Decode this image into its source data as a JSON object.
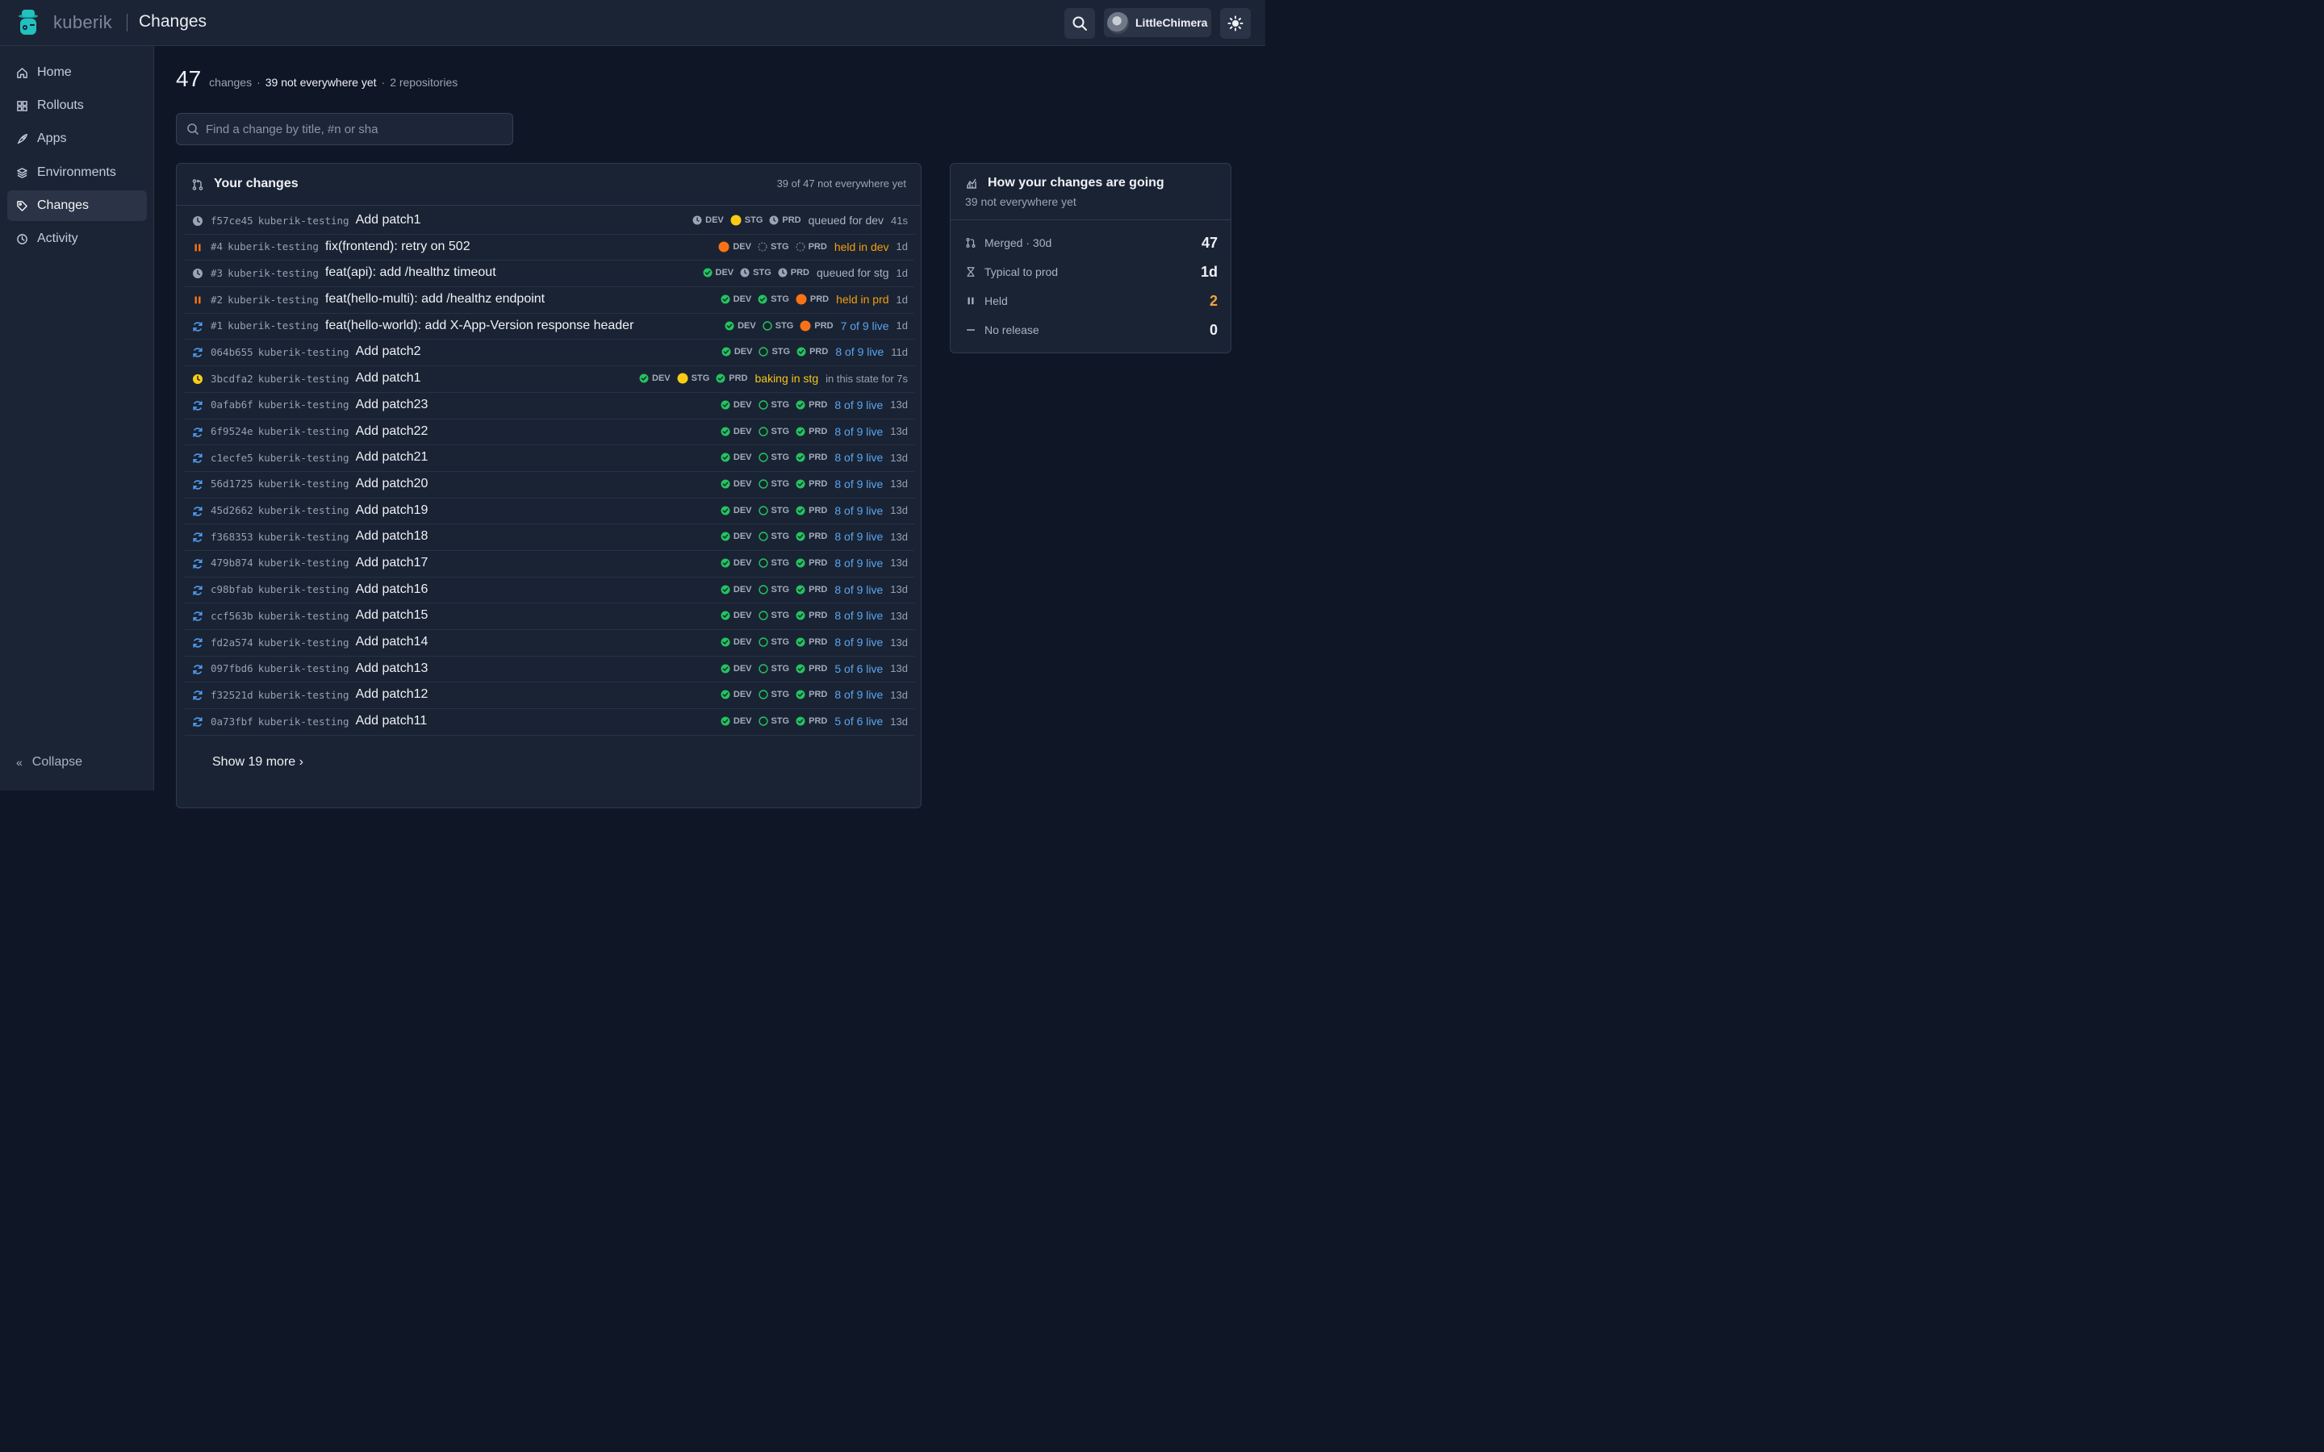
{
  "app": {
    "brand": "kuberik",
    "page_title": "Changes"
  },
  "user": {
    "name": "LittleChimera"
  },
  "sidebar": {
    "items": [
      {
        "label": "Home",
        "icon": "home-icon"
      },
      {
        "label": "Rollouts",
        "icon": "grid-icon"
      },
      {
        "label": "Apps",
        "icon": "rocket-icon"
      },
      {
        "label": "Environments",
        "icon": "layers-icon"
      },
      {
        "label": "Changes",
        "icon": "tag-icon",
        "active": true
      },
      {
        "label": "Activity",
        "icon": "clock-icon"
      }
    ],
    "collapse_label": "Collapse"
  },
  "summary": {
    "count": "47",
    "count_label": "changes",
    "not_everywhere": "39 not everywhere yet",
    "repositories": "2 repositories"
  },
  "search": {
    "placeholder": "Find a change by title, #n or sha"
  },
  "changes_panel": {
    "title": "Your changes",
    "count_text": "39 of 47 not everywhere yet",
    "show_more": "Show 19 more ›"
  },
  "env_labels": {
    "dev": "DEV",
    "stg": "STG",
    "prd": "PRD"
  },
  "rows": [
    {
      "status": "queued",
      "sha": "f57ce45",
      "repo": "kuberik-testing",
      "title": "Add patch1",
      "dev": "queued",
      "stg": "baking",
      "prd": "queued",
      "state": "queued for dev",
      "state_tone": "grey",
      "age": "41s"
    },
    {
      "status": "held",
      "sha": "#4",
      "repo": "kuberik-testing",
      "title": "fix(frontend): retry on 502",
      "dev": "held",
      "stg": "pending",
      "prd": "pending",
      "state": "held in dev",
      "state_tone": "orange",
      "age": "1d"
    },
    {
      "status": "queued",
      "sha": "#3",
      "repo": "kuberik-testing",
      "title": "feat(api): add /healthz timeout",
      "dev": "done",
      "stg": "queued",
      "prd": "queued",
      "state": "queued for stg",
      "state_tone": "grey",
      "age": "1d"
    },
    {
      "status": "held",
      "sha": "#2",
      "repo": "kuberik-testing",
      "title": "feat(hello-multi): add /healthz endpoint",
      "dev": "done",
      "stg": "done",
      "prd": "held",
      "state": "held in prd",
      "state_tone": "orange",
      "age": "1d"
    },
    {
      "status": "sync",
      "sha": "#1",
      "repo": "kuberik-testing",
      "title": "feat(hello-world): add X-App-Version response header",
      "dev": "done",
      "stg": "partial",
      "prd": "held",
      "state": "7 of 9 live",
      "state_tone": "blue",
      "age": "1d"
    },
    {
      "status": "sync",
      "sha": "064b655",
      "repo": "kuberik-testing",
      "title": "Add patch2",
      "dev": "done",
      "stg": "partial",
      "prd": "done",
      "state": "8 of 9 live",
      "state_tone": "blue",
      "age": "11d"
    },
    {
      "status": "baking",
      "sha": "3bcdfa2",
      "repo": "kuberik-testing",
      "title": "Add patch1",
      "dev": "done",
      "stg": "baking",
      "prd": "done",
      "state": "baking in stg",
      "state_tone": "yellow",
      "extra": "in this state for 7s",
      "age": ""
    },
    {
      "status": "sync",
      "sha": "0afab6f",
      "repo": "kuberik-testing",
      "title": "Add patch23",
      "dev": "done",
      "stg": "partial",
      "prd": "done",
      "state": "8 of 9 live",
      "state_tone": "blue",
      "age": "13d"
    },
    {
      "status": "sync",
      "sha": "6f9524e",
      "repo": "kuberik-testing",
      "title": "Add patch22",
      "dev": "done",
      "stg": "partial",
      "prd": "done",
      "state": "8 of 9 live",
      "state_tone": "blue",
      "age": "13d"
    },
    {
      "status": "sync",
      "sha": "c1ecfe5",
      "repo": "kuberik-testing",
      "title": "Add patch21",
      "dev": "done",
      "stg": "partial",
      "prd": "done",
      "state": "8 of 9 live",
      "state_tone": "blue",
      "age": "13d"
    },
    {
      "status": "sync",
      "sha": "56d1725",
      "repo": "kuberik-testing",
      "title": "Add patch20",
      "dev": "done",
      "stg": "partial",
      "prd": "done",
      "state": "8 of 9 live",
      "state_tone": "blue",
      "age": "13d"
    },
    {
      "status": "sync",
      "sha": "45d2662",
      "repo": "kuberik-testing",
      "title": "Add patch19",
      "dev": "done",
      "stg": "partial",
      "prd": "done",
      "state": "8 of 9 live",
      "state_tone": "blue",
      "age": "13d"
    },
    {
      "status": "sync",
      "sha": "f368353",
      "repo": "kuberik-testing",
      "title": "Add patch18",
      "dev": "done",
      "stg": "partial",
      "prd": "done",
      "state": "8 of 9 live",
      "state_tone": "blue",
      "age": "13d"
    },
    {
      "status": "sync",
      "sha": "479b874",
      "repo": "kuberik-testing",
      "title": "Add patch17",
      "dev": "done",
      "stg": "partial",
      "prd": "done",
      "state": "8 of 9 live",
      "state_tone": "blue",
      "age": "13d"
    },
    {
      "status": "sync",
      "sha": "c98bfab",
      "repo": "kuberik-testing",
      "title": "Add patch16",
      "dev": "done",
      "stg": "partial",
      "prd": "done",
      "state": "8 of 9 live",
      "state_tone": "blue",
      "age": "13d"
    },
    {
      "status": "sync",
      "sha": "ccf563b",
      "repo": "kuberik-testing",
      "title": "Add patch15",
      "dev": "done",
      "stg": "partial",
      "prd": "done",
      "state": "8 of 9 live",
      "state_tone": "blue",
      "age": "13d"
    },
    {
      "status": "sync",
      "sha": "fd2a574",
      "repo": "kuberik-testing",
      "title": "Add patch14",
      "dev": "done",
      "stg": "partial",
      "prd": "done",
      "state": "8 of 9 live",
      "state_tone": "blue",
      "age": "13d"
    },
    {
      "status": "sync",
      "sha": "097fbd6",
      "repo": "kuberik-testing",
      "title": "Add patch13",
      "dev": "done",
      "stg": "partial",
      "prd": "done",
      "state": "5 of 6 live",
      "state_tone": "blue",
      "age": "13d"
    },
    {
      "status": "sync",
      "sha": "f32521d",
      "repo": "kuberik-testing",
      "title": "Add patch12",
      "dev": "done",
      "stg": "partial",
      "prd": "done",
      "state": "8 of 9 live",
      "state_tone": "blue",
      "age": "13d"
    },
    {
      "status": "sync",
      "sha": "0a73fbf",
      "repo": "kuberik-testing",
      "title": "Add patch11",
      "dev": "done",
      "stg": "partial",
      "prd": "done",
      "state": "5 of 6 live",
      "state_tone": "blue",
      "age": "13d"
    }
  ],
  "stats": {
    "title": "How your changes are going",
    "subtitle": "39 not everywhere yet",
    "rows": [
      {
        "label": "Merged · 30d",
        "value": "47",
        "icon": "merge-icon",
        "tone": "default"
      },
      {
        "label": "Typical to prod",
        "value": "1d",
        "icon": "hourglass-icon",
        "tone": "default"
      },
      {
        "label": "Held",
        "value": "2",
        "icon": "pause-icon",
        "tone": "orange"
      },
      {
        "label": "No release",
        "value": "0",
        "icon": "dash-icon",
        "tone": "default"
      }
    ]
  },
  "colors": {
    "done": "#22c55e",
    "held": "#f97316",
    "baking": "#facc15",
    "queued": "#9aa4b4",
    "sync": "#4f9cf0",
    "bg": "#0f1626",
    "surface": "#1a2333"
  }
}
